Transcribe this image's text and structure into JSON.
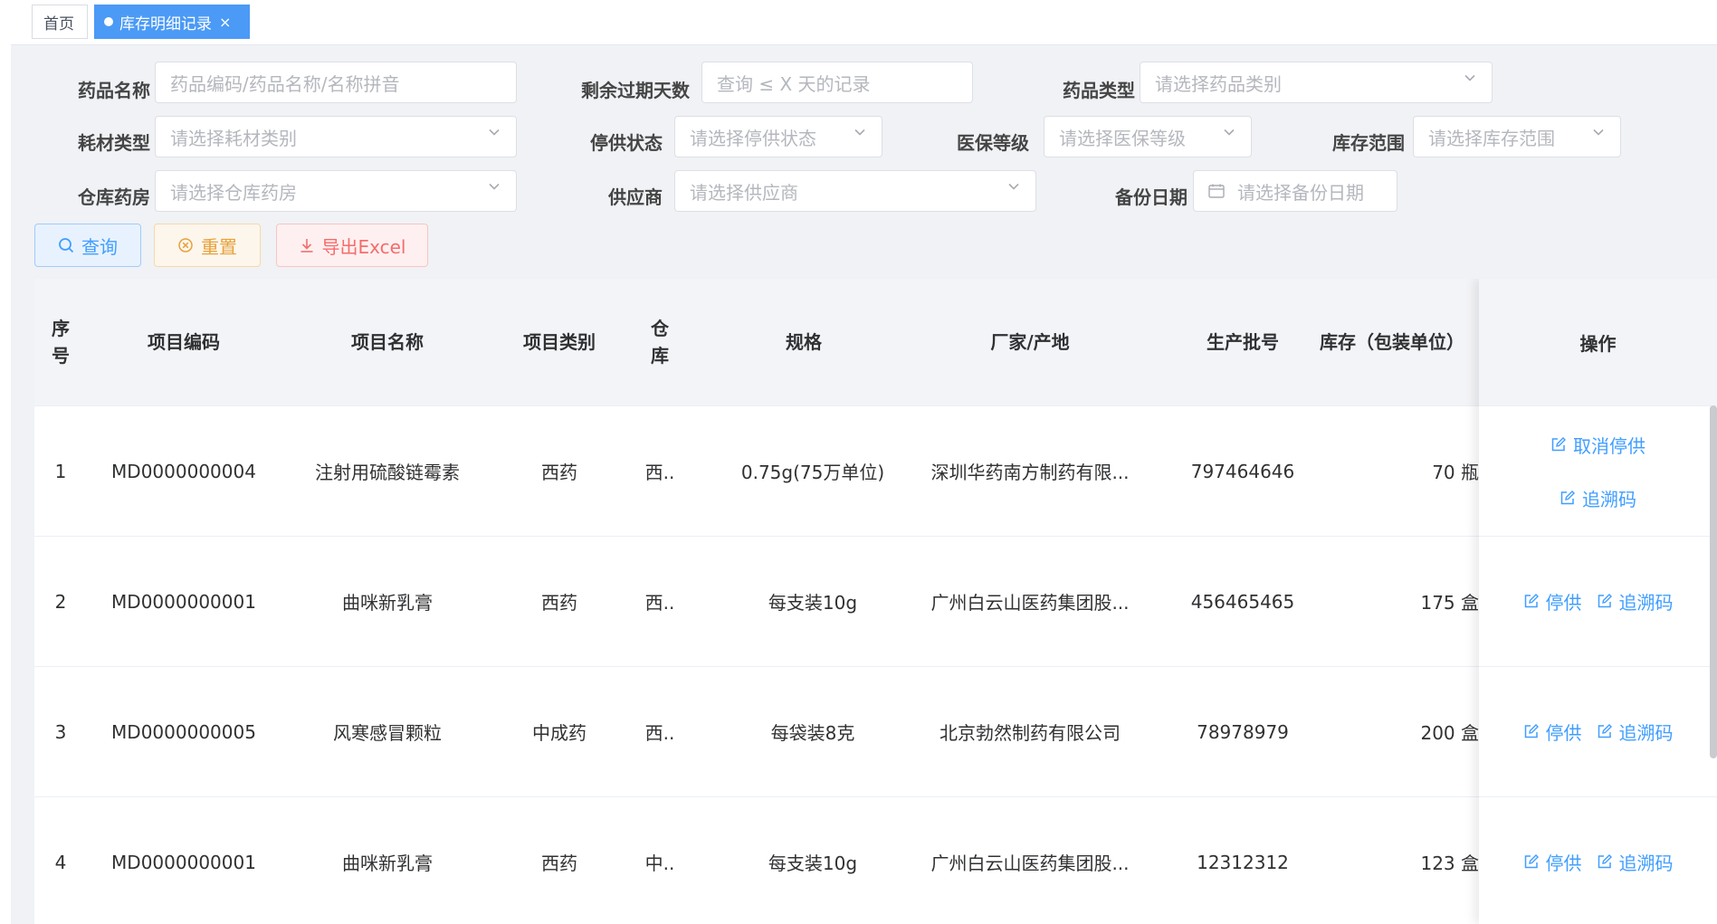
{
  "tags": {
    "home": "首页",
    "active": "库存明细记录",
    "close": "×"
  },
  "filters": {
    "drug_name": {
      "label": "药品名称",
      "placeholder": "药品编码/药品名称/名称拼音"
    },
    "expire_days": {
      "label": "剩余过期天数",
      "placeholder": "查询 ≤ X 天的记录"
    },
    "drug_type": {
      "label": "药品类型",
      "placeholder": "请选择药品类别"
    },
    "material_type": {
      "label": "耗材类型",
      "placeholder": "请选择耗材类别"
    },
    "stop_status": {
      "label": "停供状态",
      "placeholder": "请选择停供状态"
    },
    "insurance_level": {
      "label": "医保等级",
      "placeholder": "请选择医保等级"
    },
    "stock_range": {
      "label": "库存范围",
      "placeholder": "请选择库存范围"
    },
    "warehouse": {
      "label": "仓库药房",
      "placeholder": "请选择仓库药房"
    },
    "supplier": {
      "label": "供应商",
      "placeholder": "请选择供应商"
    },
    "backup_date": {
      "label": "备份日期",
      "placeholder": "请选择备份日期"
    }
  },
  "buttons": {
    "search": "查询",
    "reset": "重置",
    "export": "导出Excel"
  },
  "table": {
    "headers": {
      "seq": "序号",
      "code": "项目编码",
      "name": "项目名称",
      "category": "项目类别",
      "warehouse": "仓库",
      "spec": "规格",
      "maker": "厂家/产地",
      "batch": "生产批号",
      "stock": "库存（包装单位）",
      "ops": "操作"
    },
    "rows": [
      {
        "seq": "1",
        "code": "MD0000000004",
        "name": "注射用硫酸链霉素",
        "category": "西药",
        "warehouse": "西..",
        "spec": "0.75g(75万单位)",
        "maker": "深圳华药南方制药有限...",
        "batch": "797464646",
        "stock": "70 瓶",
        "op1": "取消停供",
        "op2": "追溯码"
      },
      {
        "seq": "2",
        "code": "MD0000000001",
        "name": "曲咪新乳膏",
        "category": "西药",
        "warehouse": "西..",
        "spec": "每支装10g",
        "maker": "广州白云山医药集团股...",
        "batch": "456465465",
        "stock": "175 盒",
        "op1": "停供",
        "op2": "追溯码"
      },
      {
        "seq": "3",
        "code": "MD0000000005",
        "name": "风寒感冒颗粒",
        "category": "中成药",
        "warehouse": "西..",
        "spec": "每袋装8克",
        "maker": "北京勃然制药有限公司",
        "batch": "78978979",
        "stock": "200 盒",
        "op1": "停供",
        "op2": "追溯码"
      },
      {
        "seq": "4",
        "code": "MD0000000001",
        "name": "曲咪新乳膏",
        "category": "西药",
        "warehouse": "中..",
        "spec": "每支装10g",
        "maker": "广州白云山医药集团股...",
        "batch": "12312312",
        "stock": "123 盒",
        "op1": "停供",
        "op2": "追溯码"
      }
    ]
  },
  "colors": {
    "primary": "#409eff",
    "warning": "#e6a23c",
    "danger": "#f56c6c",
    "tag_active": "#4b9af5"
  }
}
